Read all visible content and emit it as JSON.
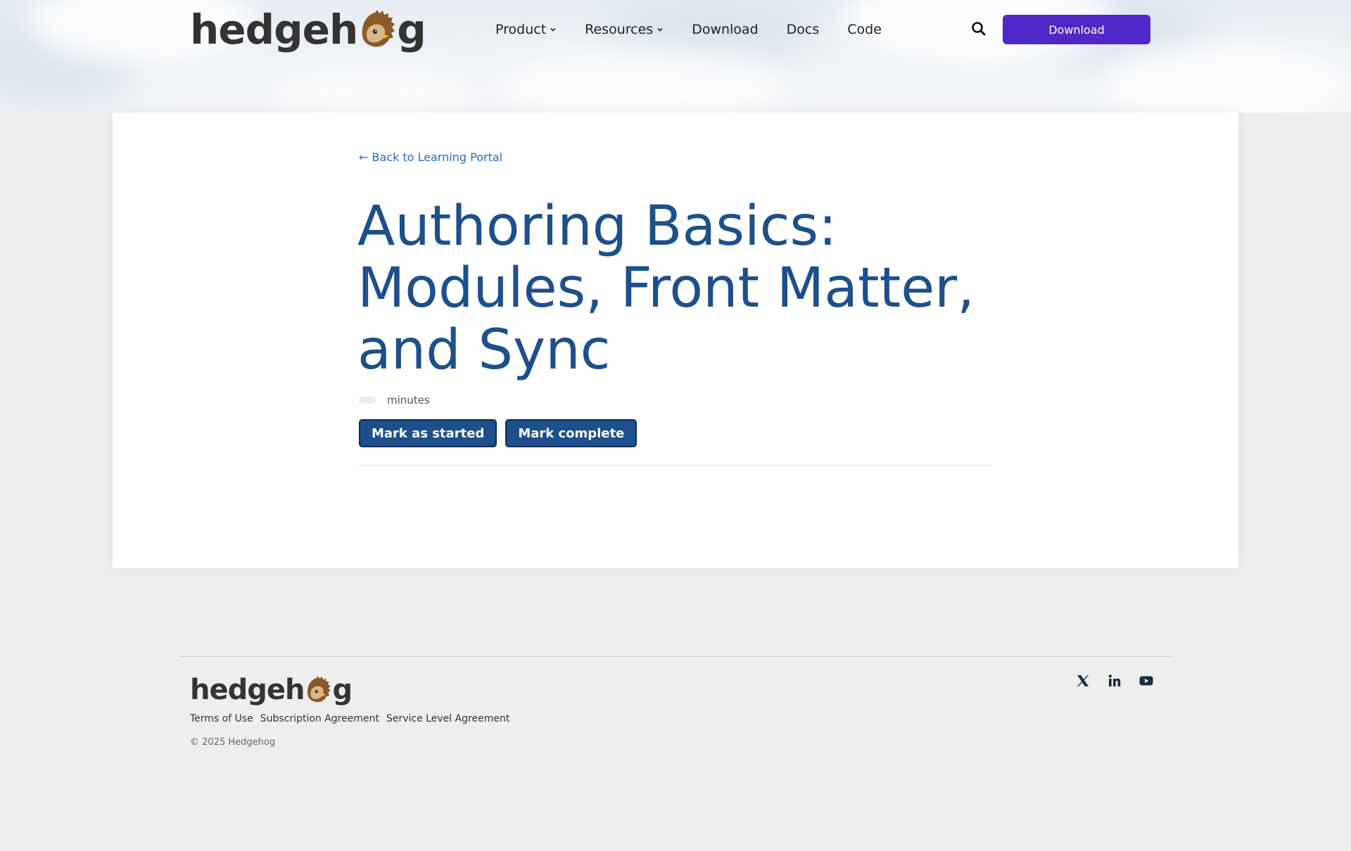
{
  "brand": {
    "name_before_o": "hedgeh",
    "name_after_o": "g",
    "o_icon": "hedgehog-face-icon"
  },
  "nav": {
    "items": [
      {
        "label": "Product",
        "has_dropdown": true
      },
      {
        "label": "Resources",
        "has_dropdown": true
      },
      {
        "label": "Download",
        "has_dropdown": false
      },
      {
        "label": "Docs",
        "has_dropdown": false
      },
      {
        "label": "Code",
        "has_dropdown": false
      }
    ],
    "search_icon": "search-icon",
    "cta_label": "Download",
    "cta_color": "#5028c8"
  },
  "article": {
    "back_link": "← Back to Learning Portal",
    "title": "Authoring Basics: Modules, Front Matter, and Sync",
    "duration_unit": "minutes",
    "buttons": {
      "started": "Mark as started",
      "complete": "Mark complete"
    },
    "title_color": "#1c4f8c",
    "link_color": "#1a6fd1"
  },
  "footer": {
    "links": [
      "Terms of Use",
      "Subscription Agreement",
      "Service Level Agreement"
    ],
    "copyright": "© 2025 Hedgehog",
    "social_icons": [
      "x-twitter-icon",
      "linkedin-icon",
      "youtube-icon"
    ]
  }
}
